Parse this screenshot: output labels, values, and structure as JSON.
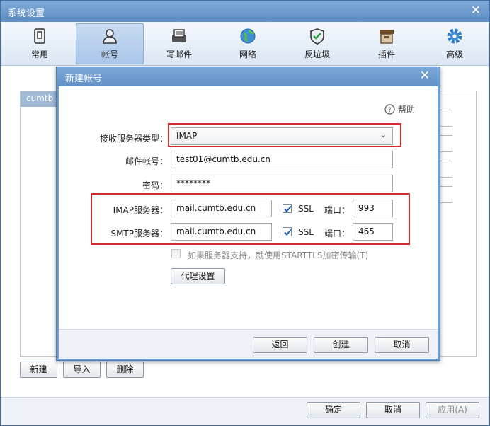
{
  "window": {
    "title": "系统设置"
  },
  "toolbar": {
    "items": [
      {
        "label": "常用",
        "icon": "general-icon"
      },
      {
        "label": "帐号",
        "icon": "account-icon",
        "active": true
      },
      {
        "label": "写邮件",
        "icon": "compose-icon"
      },
      {
        "label": "网络",
        "icon": "network-icon"
      },
      {
        "label": "反垃圾",
        "icon": "antispam-shield-icon"
      },
      {
        "label": "插件",
        "icon": "plugin-box-icon"
      },
      {
        "label": "高级",
        "icon": "advanced-gear-icon"
      }
    ]
  },
  "account_list": {
    "selected": "cumtb"
  },
  "list_buttons": {
    "new": "新建",
    "import": "导入",
    "delete": "删除"
  },
  "footer": {
    "ok": "确定",
    "cancel": "取消",
    "apply": "应用(A)"
  },
  "dialog": {
    "title": "新建帐号",
    "help": "帮助",
    "server_type_label": "接收服务器类型：",
    "server_type_value": "IMAP",
    "account_label": "邮件帐号：",
    "account_value": "test01@cumtb.edu.cn",
    "password_label": "密码：",
    "password_value": "********",
    "imap_label": "IMAP服务器：",
    "imap_value": "mail.cumtb.edu.cn",
    "imap_ssl": "SSL",
    "imap_port_label": "端口：",
    "imap_port": "993",
    "smtp_label": "SMTP服务器：",
    "smtp_value": "mail.cumtb.edu.cn",
    "smtp_ssl": "SSL",
    "smtp_port_label": "端口：",
    "smtp_port": "465",
    "starttls": "如果服务器支持，就使用STARTTLS加密传输(T)",
    "proxy_button": "代理设置",
    "back": "返回",
    "create": "创建",
    "cancel": "取消"
  },
  "colors": {
    "highlight_border": "#d02b33",
    "title_bar": "#6391c6",
    "check": "#1c5fb0"
  }
}
